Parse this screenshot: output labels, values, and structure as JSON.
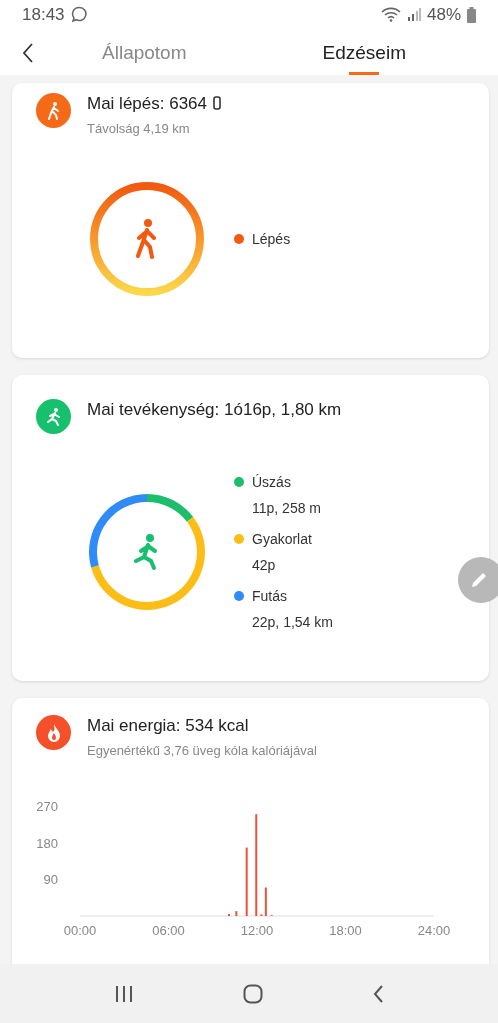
{
  "status_bar": {
    "time": "18:43",
    "battery": "48%"
  },
  "tabs": [
    {
      "label": "Állapotom",
      "selected": false
    },
    {
      "label": "Edzéseim",
      "selected": true
    }
  ],
  "cards": [
    {
      "kind": "steps",
      "color": "#f46a16",
      "title": "Mai lépés: 6364",
      "subtitle": "Távolság 4,19 km",
      "legend": [
        {
          "name": "Lépés",
          "color": "#f15a0f"
        }
      ]
    },
    {
      "kind": "activity",
      "color": "#17c06c",
      "title": "Mai tevékenység: 1ó16p, 1,80 km",
      "legend": [
        {
          "name": "Úszás",
          "detail": "11p, 258 m",
          "color": "#1cbd6b"
        },
        {
          "name": "Gyakorlat",
          "detail": "42p",
          "color": "#fbbd16"
        },
        {
          "name": "Futás",
          "detail": "22p, 1,54 km",
          "color": "#2f8bf5"
        }
      ],
      "chart_data": {
        "type": "donut",
        "values": [
          14.7,
          56,
          29.3
        ]
      }
    },
    {
      "kind": "energy",
      "color": "#f4502a",
      "title": "Mai energia: 534 kcal",
      "subtitle": "Egyenértékű 3,76 üveg kóla kalóriájával",
      "chart_data": {
        "type": "bar",
        "x": [
          10.1,
          10.6,
          11.3,
          11.95,
          12.3,
          12.6,
          13.0
        ],
        "values": [
          5,
          12,
          168,
          250,
          4,
          70,
          2
        ],
        "xlim": [
          0,
          24
        ],
        "ylim": [
          0,
          270
        ],
        "xticks": [
          {
            "value": 0,
            "label": "00:00"
          },
          {
            "value": 6,
            "label": "06:00"
          },
          {
            "value": 12,
            "label": "12:00"
          },
          {
            "value": 18,
            "label": "18:00"
          },
          {
            "value": 24,
            "label": "24:00"
          }
        ],
        "yticks": [
          90,
          180,
          270
        ]
      }
    }
  ]
}
